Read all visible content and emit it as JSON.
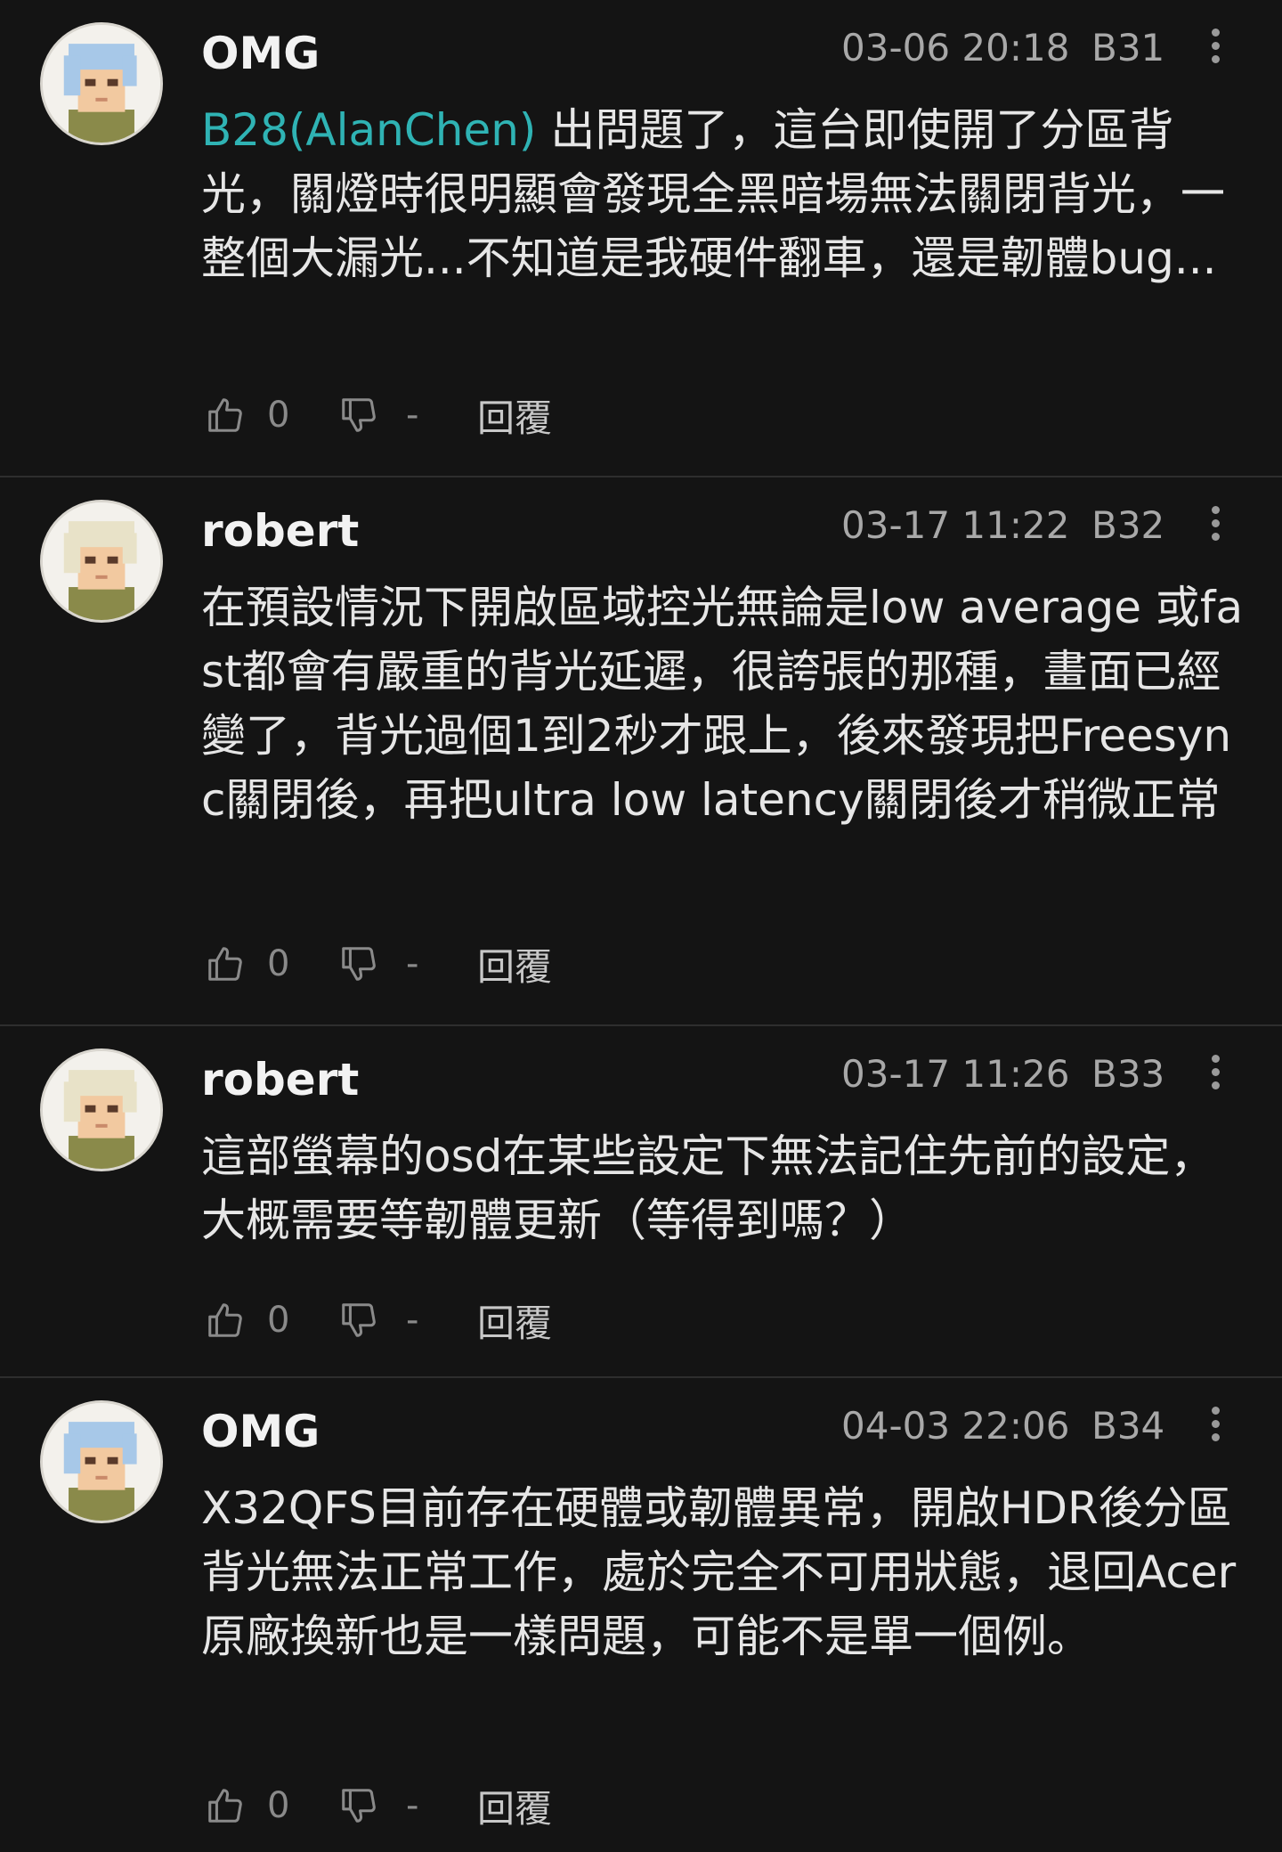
{
  "colors": {
    "background": "#141414",
    "divider": "#2e2e2e",
    "mention": "#2fb3b4",
    "meta": "#a8a8a8",
    "action": "#8a8a8a"
  },
  "comments": [
    {
      "author": "OMG",
      "time": "03-06 20:18",
      "floor": "B31",
      "mention": "B28(AlanChen)",
      "text": " 出問題了，這台即使開了分區背光，關燈時很明顯會發現全黑暗場無法關閉背光，一整個大漏光...不知道是我硬件翻車，還是韌體bug...",
      "likes": "0",
      "dislikes": "-",
      "reply_label": "回覆",
      "avatar": "blue-hair-avatar"
    },
    {
      "author": "robert",
      "time": "03-17 11:22",
      "floor": "B32",
      "mention": "",
      "text": "在預設情況下開啟區域控光無論是low average 或fast都會有嚴重的背光延遲，很誇張的那種，畫面已經變了，背光過個1到2秒才跟上，後來發現把Freesync關閉後，再把ultra low latency關閉後才稍微正常",
      "likes": "0",
      "dislikes": "-",
      "reply_label": "回覆",
      "avatar": "blonde-hair-avatar"
    },
    {
      "author": "robert",
      "time": "03-17 11:26",
      "floor": "B33",
      "mention": "",
      "text": "這部螢幕的osd在某些設定下無法記住先前的設定，大概需要等韌體更新（等得到嗎？）",
      "likes": "0",
      "dislikes": "-",
      "reply_label": "回覆",
      "avatar": "blonde-hair-avatar"
    },
    {
      "author": "OMG",
      "time": "04-03 22:06",
      "floor": "B34",
      "mention": "",
      "text": "X32QFS目前存在硬體或韌體異常，開啟HDR後分區背光無法正常工作，處於完全不可用狀態，退回Acer原廠換新也是一樣問題，可能不是單一個例。",
      "likes": "0",
      "dislikes": "-",
      "reply_label": "回覆",
      "avatar": "blue-hair-avatar"
    }
  ]
}
